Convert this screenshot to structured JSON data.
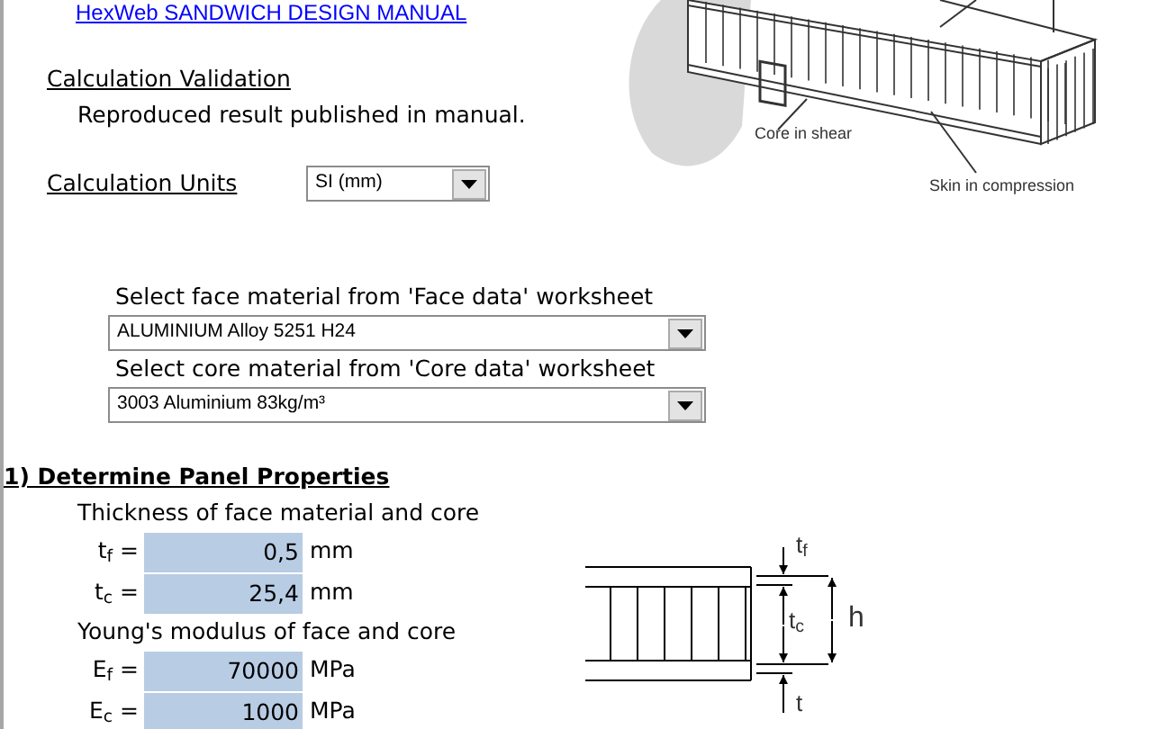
{
  "manual_link": {
    "text": "HexWeb SANDWICH DESIGN MANUAL"
  },
  "validation": {
    "heading": "Calculation Validation",
    "text": "Reproduced result published in manual."
  },
  "units": {
    "label": "Calculation Units",
    "value": "SI (mm)"
  },
  "materials": [
    {
      "label": "Select face material from 'Face data' worksheet",
      "value": "ALUMINIUM Alloy 5251 H24"
    },
    {
      "label": "Select core material from 'Core data' worksheet",
      "value": "3003 Aluminium  83kg/m³"
    }
  ],
  "section": {
    "heading": "1) Determine Panel Properties",
    "groups": [
      {
        "title": "Thickness of face material and core",
        "rows": [
          {
            "symbol": "t$_{f}$ =",
            "value": "0,5",
            "unit": "mm"
          },
          {
            "symbol": "t$_{c}$ =",
            "value": "25,4",
            "unit": "mm"
          }
        ]
      },
      {
        "title": "Young's modulus of face and core",
        "rows": [
          {
            "symbol": "E$_{f}$ =",
            "value": "70000",
            "unit": "MPa"
          },
          {
            "symbol": "E$_{c}$ =",
            "value": "1000",
            "unit": "MPa"
          }
        ]
      }
    ]
  },
  "beam_figure": {
    "labels": [
      "Core in shear",
      "Skin in compression"
    ]
  },
  "cross_section": {
    "labels": [
      "t$_{f}$",
      "t$_{c}$",
      "h",
      "t"
    ]
  }
}
